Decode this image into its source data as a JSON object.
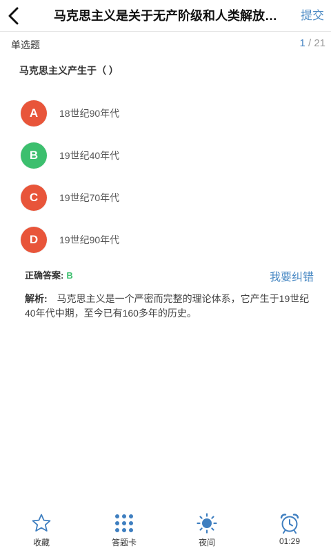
{
  "header": {
    "title": "马克思主义是关于无产阶级和人类解放…",
    "submit_label": "提交"
  },
  "question_meta": {
    "type_label": "单选题",
    "current": "1",
    "separator": " / ",
    "total": "21"
  },
  "question": {
    "text": "马克思主义产生于（    ）"
  },
  "options": [
    {
      "letter": "A",
      "text": "18世纪90年代",
      "color": "#e8553a"
    },
    {
      "letter": "B",
      "text": "19世纪40年代",
      "color": "#3cbf6e"
    },
    {
      "letter": "C",
      "text": "19世纪70年代",
      "color": "#e8553a"
    },
    {
      "letter": "D",
      "text": "19世纪90年代",
      "color": "#e8553a"
    }
  ],
  "answer": {
    "label": "正确答案:",
    "value": "B",
    "report_label": "我要纠错"
  },
  "analysis": {
    "label": "解析:",
    "text": "马克思主义是一个严密而完整的理论体系，它产生于19世纪40年代中期，至今已有160多年的历史。"
  },
  "bottom_bar": {
    "tabs": [
      {
        "label": "收藏",
        "icon": "star-icon"
      },
      {
        "label": "答题卡",
        "icon": "grid-icon"
      },
      {
        "label": "夜间",
        "icon": "sun-icon"
      },
      {
        "label": "01:29",
        "icon": "alarm-clock-icon"
      }
    ]
  },
  "colors": {
    "accent_blue": "#4b8ac4",
    "correct_green": "#3cbf6e",
    "wrong_red": "#e8553a"
  }
}
